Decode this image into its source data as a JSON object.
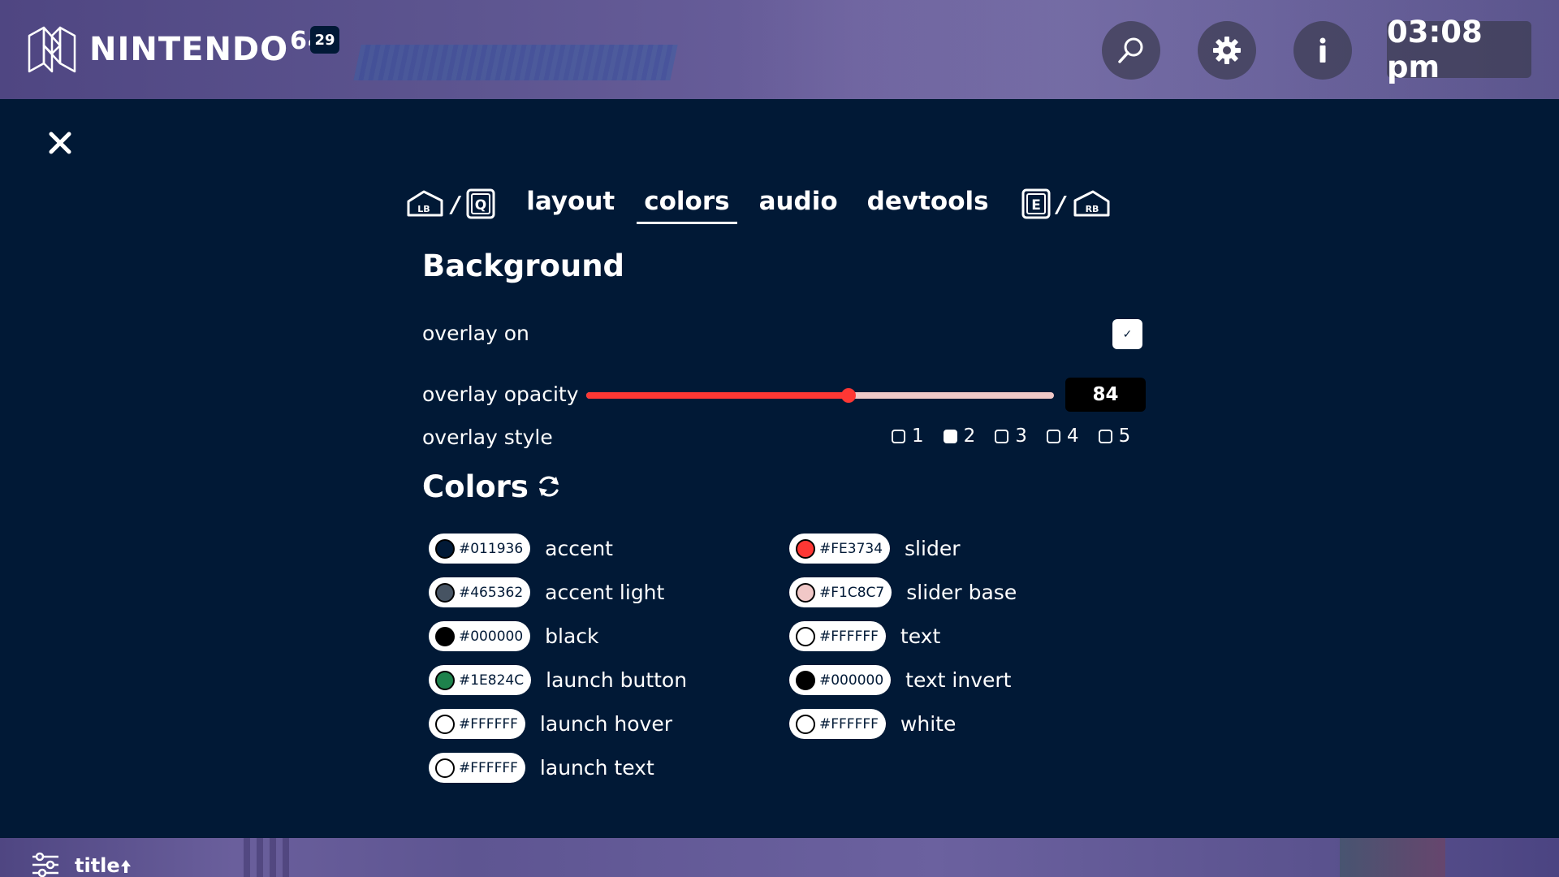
{
  "header": {
    "logo_text": "NINTENDO",
    "logo_sup": "64",
    "badge_count": "29",
    "icons": [
      "search-icon",
      "gear-icon",
      "info-icon"
    ],
    "clock": "03:08 pm"
  },
  "tabs": {
    "prev_keys": [
      "LB",
      "Q"
    ],
    "next_keys": [
      "E",
      "RB"
    ],
    "items": [
      {
        "label": "layout",
        "active": false
      },
      {
        "label": "colors",
        "active": true
      },
      {
        "label": "audio",
        "active": false
      },
      {
        "label": "devtools",
        "active": false
      }
    ]
  },
  "background": {
    "title": "Background",
    "overlay_on_label": "overlay on",
    "overlay_on_checked": true,
    "overlay_opacity_label": "overlay opacity",
    "overlay_opacity_value": "84",
    "overlay_opacity_fraction": 0.56,
    "overlay_style_label": "overlay style",
    "overlay_styles": [
      {
        "label": "1",
        "selected": false
      },
      {
        "label": "2",
        "selected": true
      },
      {
        "label": "3",
        "selected": false
      },
      {
        "label": "4",
        "selected": false
      },
      {
        "label": "5",
        "selected": false
      }
    ]
  },
  "colors": {
    "title": "Colors",
    "left": [
      {
        "hex": "#011936",
        "name": "accent"
      },
      {
        "hex": "#465362",
        "name": "accent light"
      },
      {
        "hex": "#000000",
        "name": "black"
      },
      {
        "hex": "#1E824C",
        "name": "launch button"
      },
      {
        "hex": "#FFFFFF",
        "name": "launch hover"
      },
      {
        "hex": "#FFFFFF",
        "name": "launch text"
      }
    ],
    "right": [
      {
        "hex": "#FE3734",
        "name": "slider"
      },
      {
        "hex": "#F1C8C7",
        "name": "slider base"
      },
      {
        "hex": "#FFFFFF",
        "name": "text"
      },
      {
        "hex": "#000000",
        "name": "text invert"
      },
      {
        "hex": "#FFFFFF",
        "name": "white"
      }
    ]
  },
  "footer": {
    "sort_label": "title"
  },
  "theme": {
    "background": "#011936",
    "slider": "#FE3734",
    "slider_base": "#F1C8C7"
  }
}
